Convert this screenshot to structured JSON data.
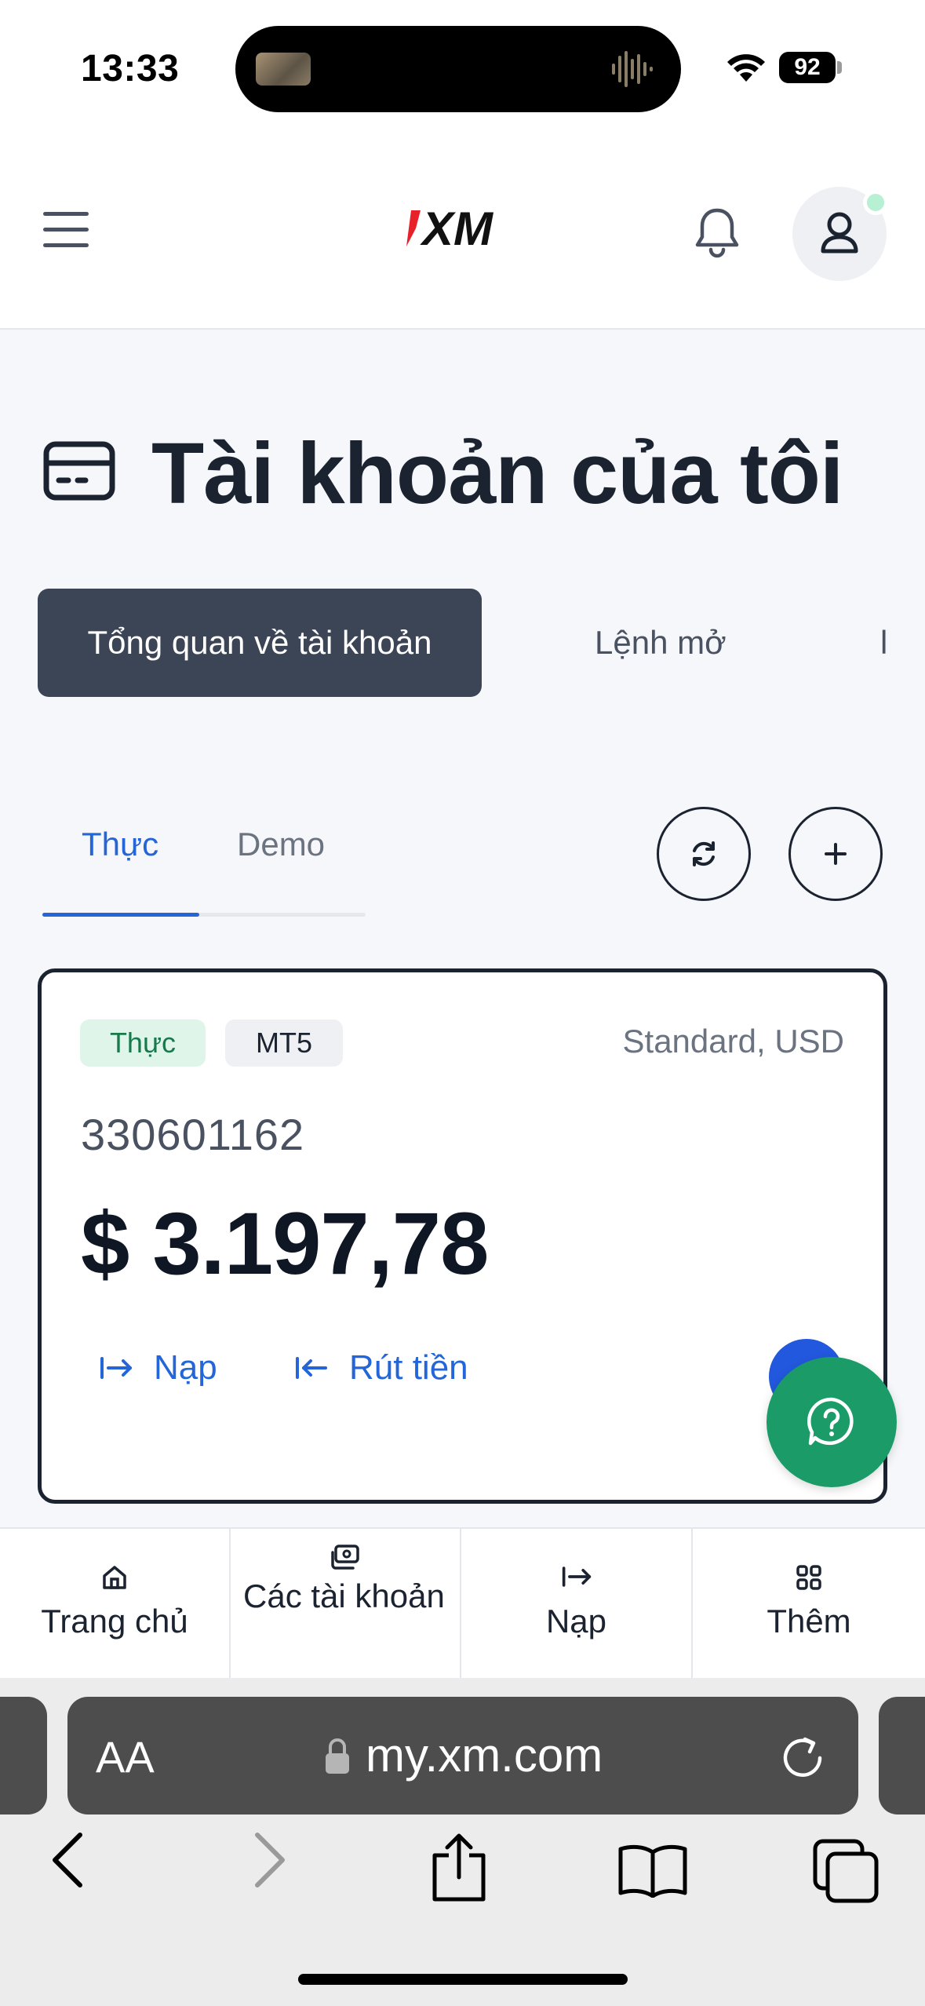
{
  "status_bar": {
    "time": "13:33",
    "battery": "92"
  },
  "header": {
    "logo_text": "XM",
    "menu_icon": "hamburger-icon",
    "notification_icon": "bell-icon",
    "profile_icon": "user-icon"
  },
  "page": {
    "title": "Tài khoản của tôi",
    "title_icon": "card-icon"
  },
  "top_tabs": [
    {
      "label": "Tổng quan về tài khoản",
      "active": true
    },
    {
      "label": "Lệnh mở",
      "active": false
    },
    {
      "label": "l",
      "active": false
    }
  ],
  "sub_tabs": [
    {
      "label": "Thực",
      "active": true
    },
    {
      "label": "Demo",
      "active": false
    }
  ],
  "account": {
    "badges": [
      "Thực",
      "MT5"
    ],
    "type": "Standard, USD",
    "number": "330601162",
    "balance": "$ 3.197,78",
    "actions": [
      {
        "label": "Nạp",
        "icon": "deposit-arrow-icon"
      },
      {
        "label": "Rút tiền",
        "icon": "withdraw-arrow-icon"
      }
    ]
  },
  "bottom_nav": [
    {
      "label": "Trang chủ",
      "icon": "home-icon"
    },
    {
      "label": "Các tài khoản",
      "icon": "accounts-icon"
    },
    {
      "label": "Nạp",
      "icon": "deposit-arrow-icon"
    },
    {
      "label": "Thêm",
      "icon": "grid-icon"
    }
  ],
  "browser": {
    "text_size_label": "AA",
    "url": "my.xm.com"
  },
  "colors": {
    "accent": "#2466d8",
    "dark": "#3c4556",
    "help": "#1a9b67",
    "badge_green_bg": "#dff5ea",
    "badge_green_fg": "#187a4c"
  }
}
